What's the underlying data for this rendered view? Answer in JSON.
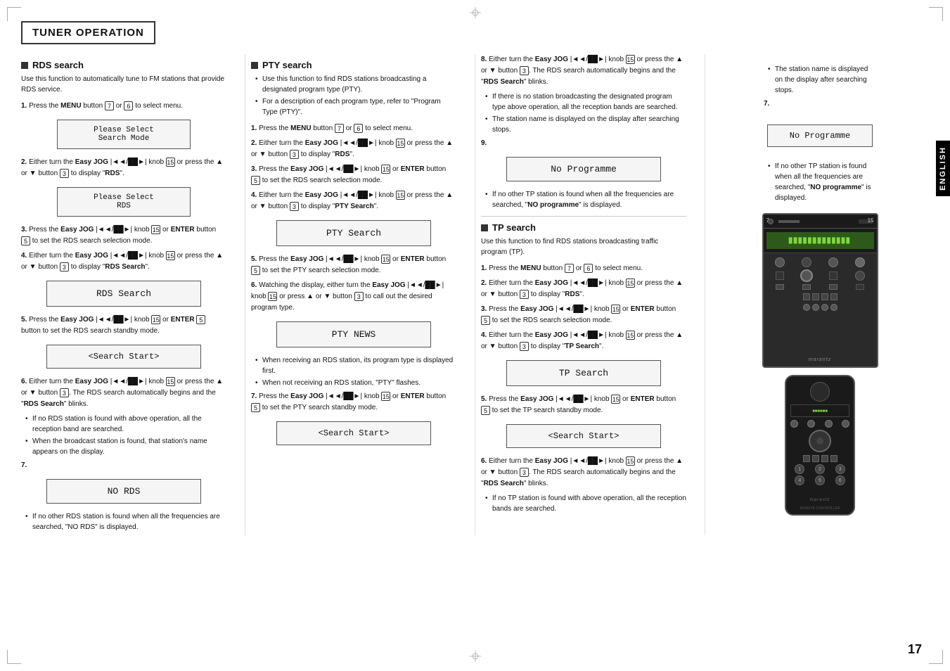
{
  "page": {
    "title": "TUNER OPERATION",
    "page_number": "17",
    "language_tab": "ENGLISH"
  },
  "rds_search": {
    "heading": "RDS search",
    "intro": "Use this function to automatically tune to FM stations that provide RDS service.",
    "steps": [
      {
        "num": "1.",
        "text": "Press the MENU button",
        "suffix": " or  to select menu."
      },
      {
        "num": "2.",
        "text": "Either turn the Easy JOG |◄◄/►►| knob  or press the ▲ or ▼ button  to display \"RDS\"."
      },
      {
        "num": "3.",
        "text": "Press the Easy JOG |◄◄/►►| knob  or ENTER button  to set the RDS search selection mode."
      },
      {
        "num": "4.",
        "text": "Either turn the Easy JOG |◄◄/██►| knob  or press the ▲ or ▼ button  to display \"RDS Search\"."
      },
      {
        "num": "5.",
        "text": "Press the Easy JOG |◄◄/██►| knob  or ENTER  button  to set the RDS search standby mode."
      },
      {
        "num": "6.",
        "text": "Either turn the Easy JOG |◄◄/██►| knob  or press the ▲ or ▼ button . The RDS search automatically begins and the \"RDS Search\" blinks."
      },
      {
        "num": "7.",
        "text": ""
      }
    ],
    "display_1": "Please Select\nSearch Mode",
    "display_2": "Please Select\nRDS",
    "display_3": "RDS Search",
    "display_4": "<Search Start>",
    "display_5": "NO RDS",
    "bullet_1": "If no other RDS station is found when all the frequencies are searched, \"NO RDS\" is displayed.",
    "bullet_6a": "If no RDS station is found with above operation, all the reception band are searched.",
    "bullet_6b": "When the broadcast station is found, that station's name appears on the display."
  },
  "pty_search": {
    "heading": "PTY search",
    "intro_bullets": [
      "Use this function to find RDS stations broadcasting a designated program type (PTY).",
      "For a description of each program type, refer to \"Program Type (PTY)\"."
    ],
    "steps": [
      {
        "num": "1.",
        "text": "Press the MENU button  or  to select menu."
      },
      {
        "num": "2.",
        "text": "Either turn the Easy JOG |◄◄/██►| knob  or press the ▲ or ▼ button  to display \"RDS\"."
      },
      {
        "num": "3.",
        "text": "Press the Easy JOG |◄◄/██►| knob  or ENTER button  to set the RDS search selection mode."
      },
      {
        "num": "4.",
        "text": "Either turn the Easy JOG |◄◄/██►| knob  or press the ▲ or ▼ button  to display \"PTY Search\"."
      },
      {
        "num": "5.",
        "text": "Press the Easy JOG |◄◄/██►| knob  or ENTER button  to set the PTY search selection mode."
      },
      {
        "num": "6.",
        "text": "Watching the display, either turn the Easy JOG |◄◄/██►| knob  or press ▲ or ▼ button  to call out the desired program type."
      },
      {
        "num": "7.",
        "text": "Press the Easy JOG |◄◄/██►| knob  or ENTER button  to set the PTY search standby mode."
      }
    ],
    "display_pty_search": "PTY Search",
    "display_pty_news": "PTY NEWS",
    "display_search_start": "<Search Start>",
    "bullet_when": "When receiving an RDS station, its program type is displayed first.",
    "bullet_when_not": "When not receiving an RDS station, \"PTY\" flashes."
  },
  "tp_search": {
    "heading": "TP search",
    "intro": "Use this function to find RDS stations broadcasting traffic program (TP).",
    "steps": [
      {
        "num": "1.",
        "text": "Press the MENU button  or  to select menu."
      },
      {
        "num": "2.",
        "text": "Either turn the Easy JOG |◄◄/██►| knob  or press the ▲ or ▼ button  to display \"RDS\"."
      },
      {
        "num": "3.",
        "text": "Press the Easy JOG |◄◄/██►| knob  or ENTER button  to set the RDS search selection mode."
      },
      {
        "num": "4.",
        "text": "Either turn the Easy JOG |◄◄/██►| knob  or press the ▲ or ▼ button  to display \"TP Search\"."
      },
      {
        "num": "5.",
        "text": "Press the Easy JOG |◄◄/██►| knob  or ENTER button  to set the TP search standby mode."
      },
      {
        "num": "6.",
        "text": "Either turn the Easy JOG |◄◄/██►| knob  or press the ▲ or ▼ button . The RDS search automatically begins and the \"RDS Search\" blinks."
      }
    ],
    "display_tp_search": "TP Search",
    "display_search_start": "<Search Start>",
    "step8_text": "Either turn the Easy JOG |◄◄/██►| knob  or press the ▲ or ▼ button . The RDS search automatically begins and the \"RDS Search\" blinks.",
    "step9_text": "",
    "bullet_8a": "If there is no station broadcasting the designated program type above operation, all the reception bands are searched.",
    "bullet_8b": "The station name is displayed on the display after searching stops.",
    "step7_display": "No Programme",
    "step9_display": "No Programme",
    "bullet_7": "If no other TP station is found when all the frequencies are searched, \"NO programme\" is displayed.",
    "bullet_6a": "If no TP station is found with above operation, all the reception bands are searched."
  }
}
